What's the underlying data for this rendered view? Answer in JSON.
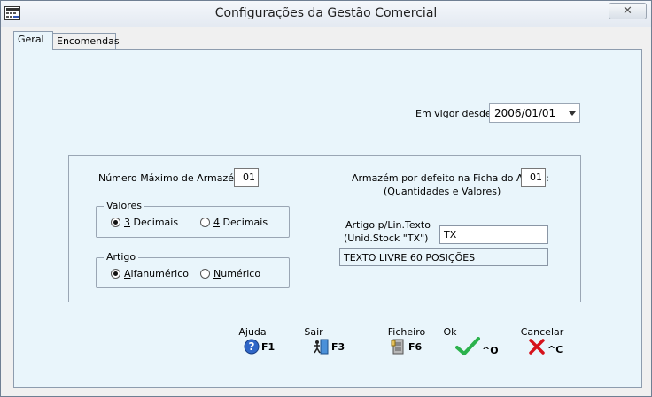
{
  "window": {
    "title": "Configurações da Gestão Comercial",
    "app_icon": "app-grid-icon",
    "close_icon": "close-icon"
  },
  "tabs": [
    {
      "label": "Geral",
      "active": true
    },
    {
      "label": "Encomendas",
      "active": false
    }
  ],
  "vigor": {
    "label": "Em vigor desde :",
    "value": "2006/01/01"
  },
  "armazens": {
    "max_label": "Número Máximo de Armazéns:",
    "max_value": "01",
    "default_label": "Armazém por defeito na Ficha do Artigo:",
    "default_sublabel": "(Quantidades e Valores)",
    "default_value": "01"
  },
  "valores": {
    "title": "Valores",
    "options": [
      {
        "prefix": "3",
        "rest": " Decimais",
        "selected": true
      },
      {
        "prefix": "4",
        "rest": " Decimais",
        "selected": false
      }
    ]
  },
  "artigo": {
    "title": "Artigo",
    "options": [
      {
        "prefix": "A",
        "rest": "lfanumérico",
        "selected": true
      },
      {
        "prefix": "N",
        "rest": "umérico",
        "selected": false
      }
    ]
  },
  "linha_texto": {
    "label_line1": "Artigo p/Lin.Texto",
    "label_line2": "(Unid.Stock \"TX\")",
    "value": "TX",
    "description": "TEXTO LIVRE 60 POSIÇÕES"
  },
  "toolbar": {
    "buttons": [
      {
        "label": "Ajuda",
        "key": "F1",
        "icon": "help-icon"
      },
      {
        "label": "Sair",
        "key": "F3",
        "icon": "exit-door-icon"
      },
      {
        "label": "Ficheiro",
        "key": "F6",
        "icon": "file-cabinet-icon"
      },
      {
        "label": "Ok",
        "key": "^O",
        "icon": "checkmark-icon"
      },
      {
        "label": "Cancelar",
        "key": "^C",
        "icon": "red-x-icon"
      }
    ]
  },
  "colors": {
    "panel_bg": "#e9f5fb",
    "window_bg": "#f0f0f0",
    "ok_green": "#2bb24c",
    "cancel_red": "#d6121b"
  }
}
